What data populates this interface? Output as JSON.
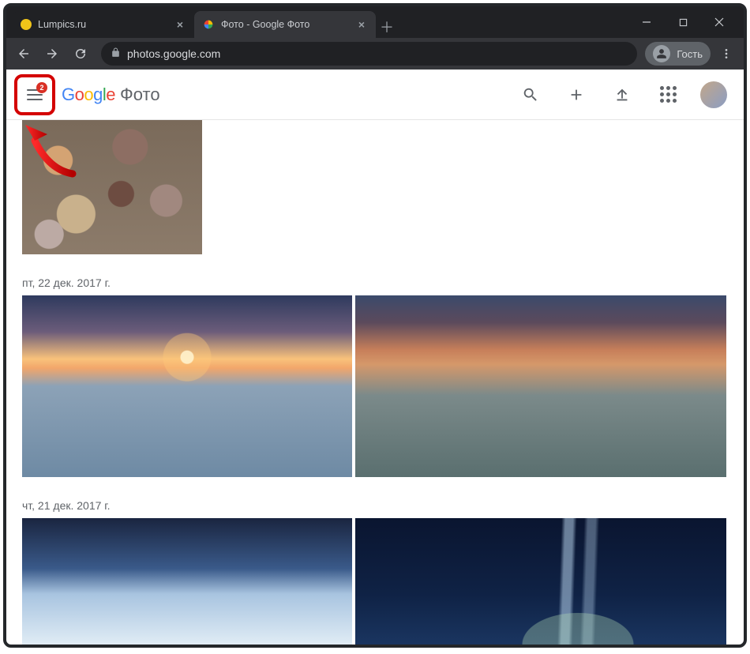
{
  "browser": {
    "tabs": [
      {
        "title": "Lumpics.ru",
        "active": false
      },
      {
        "title": "Фото - Google Фото",
        "active": true
      }
    ],
    "url_host": "photos.google.com",
    "guest_label": "Гость"
  },
  "appbar": {
    "menu_badge": "2",
    "logo_brand": "Google",
    "product_name": "Фото"
  },
  "sections": [
    {
      "date_label": "пт, 22 дек. 2017 г."
    },
    {
      "date_label": "чт, 21 дек. 2017 г."
    }
  ]
}
